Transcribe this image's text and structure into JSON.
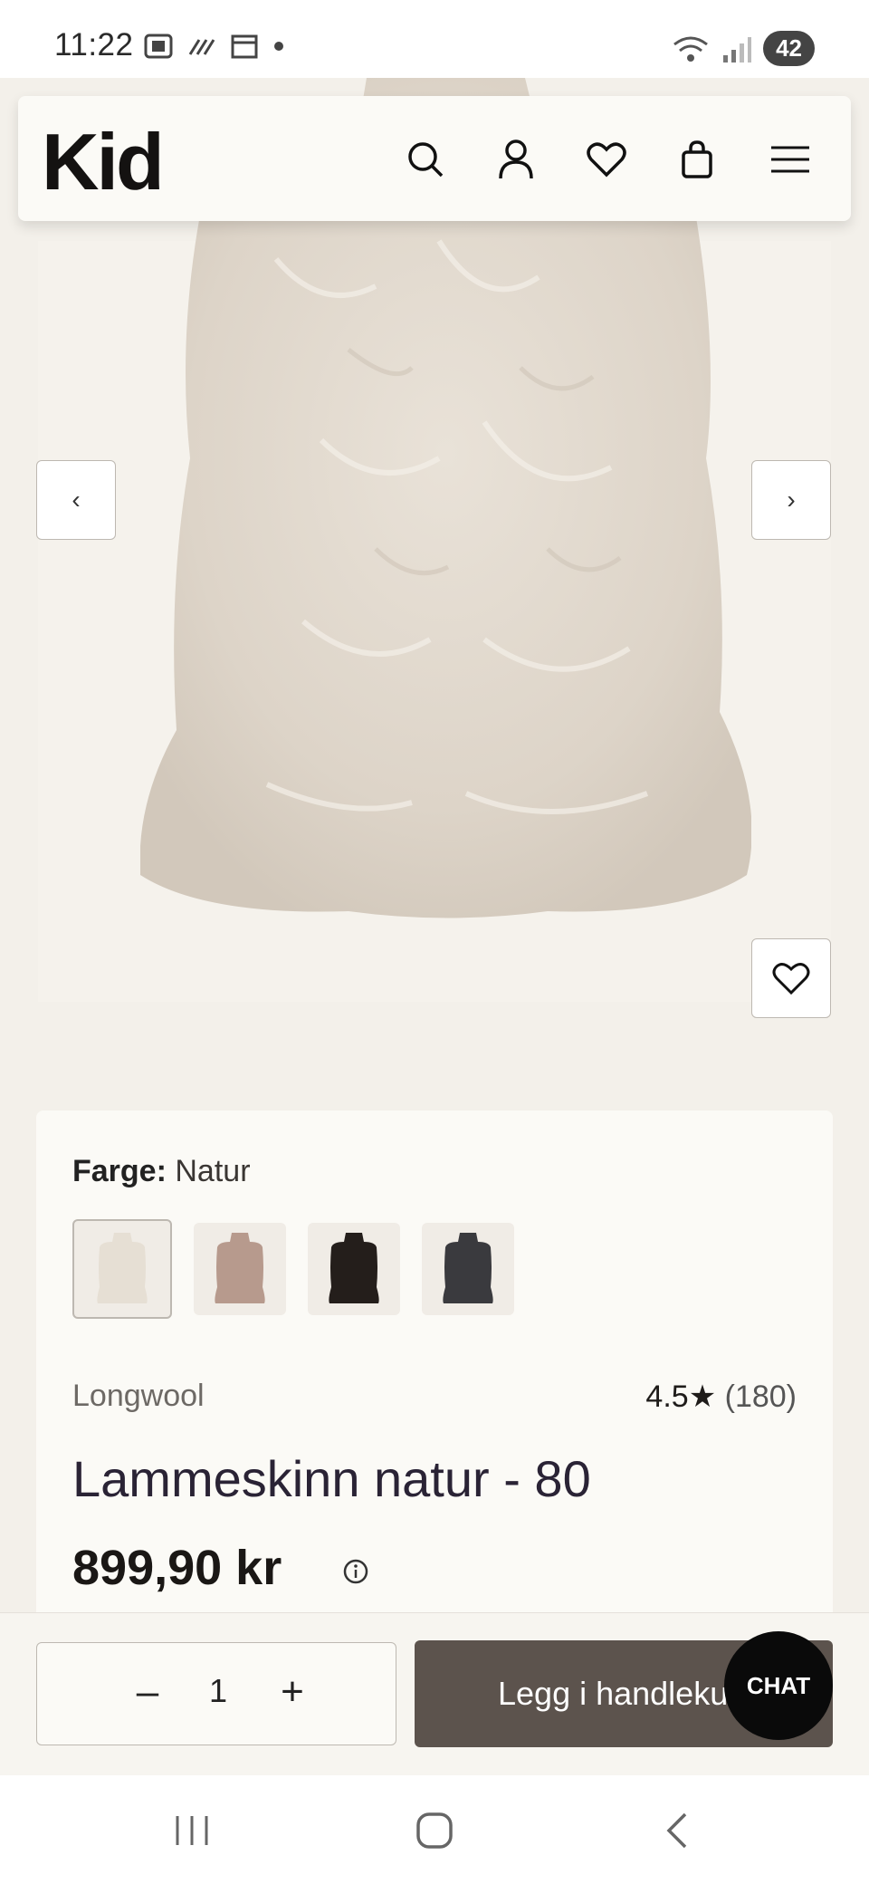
{
  "status_bar": {
    "time": "11:22",
    "battery": "42",
    "wifi_label": "5"
  },
  "header": {
    "logo": "Kid",
    "icons": [
      "search-icon",
      "account-icon",
      "heart-icon",
      "bag-icon",
      "menu-icon"
    ]
  },
  "gallery": {
    "prev_label": "‹",
    "next_label": "›"
  },
  "product": {
    "color_label": "Farge:",
    "color_value": "Natur",
    "swatches": [
      {
        "name": "Natur",
        "color": "#e6dfd4",
        "selected": true
      },
      {
        "name": "Rose",
        "color": "#b79a8d",
        "selected": false
      },
      {
        "name": "Black",
        "color": "#241e1b",
        "selected": false
      },
      {
        "name": "Grey",
        "color": "#3a3a3e",
        "selected": false
      }
    ],
    "brand": "Longwool",
    "rating_value": "4.5",
    "rating_star": "★",
    "rating_count": "(180)",
    "title": "Lammeskinn natur - 80",
    "price": "899,90 kr"
  },
  "cart": {
    "quantity": "1",
    "minus_label": "–",
    "plus_label": "+",
    "add_label": "Legg i handlekurv",
    "chat_label": "CHAT"
  },
  "colors": {
    "accent_button": "#5c534d",
    "background": "#f3f0ea",
    "card": "#fbfaf6"
  }
}
